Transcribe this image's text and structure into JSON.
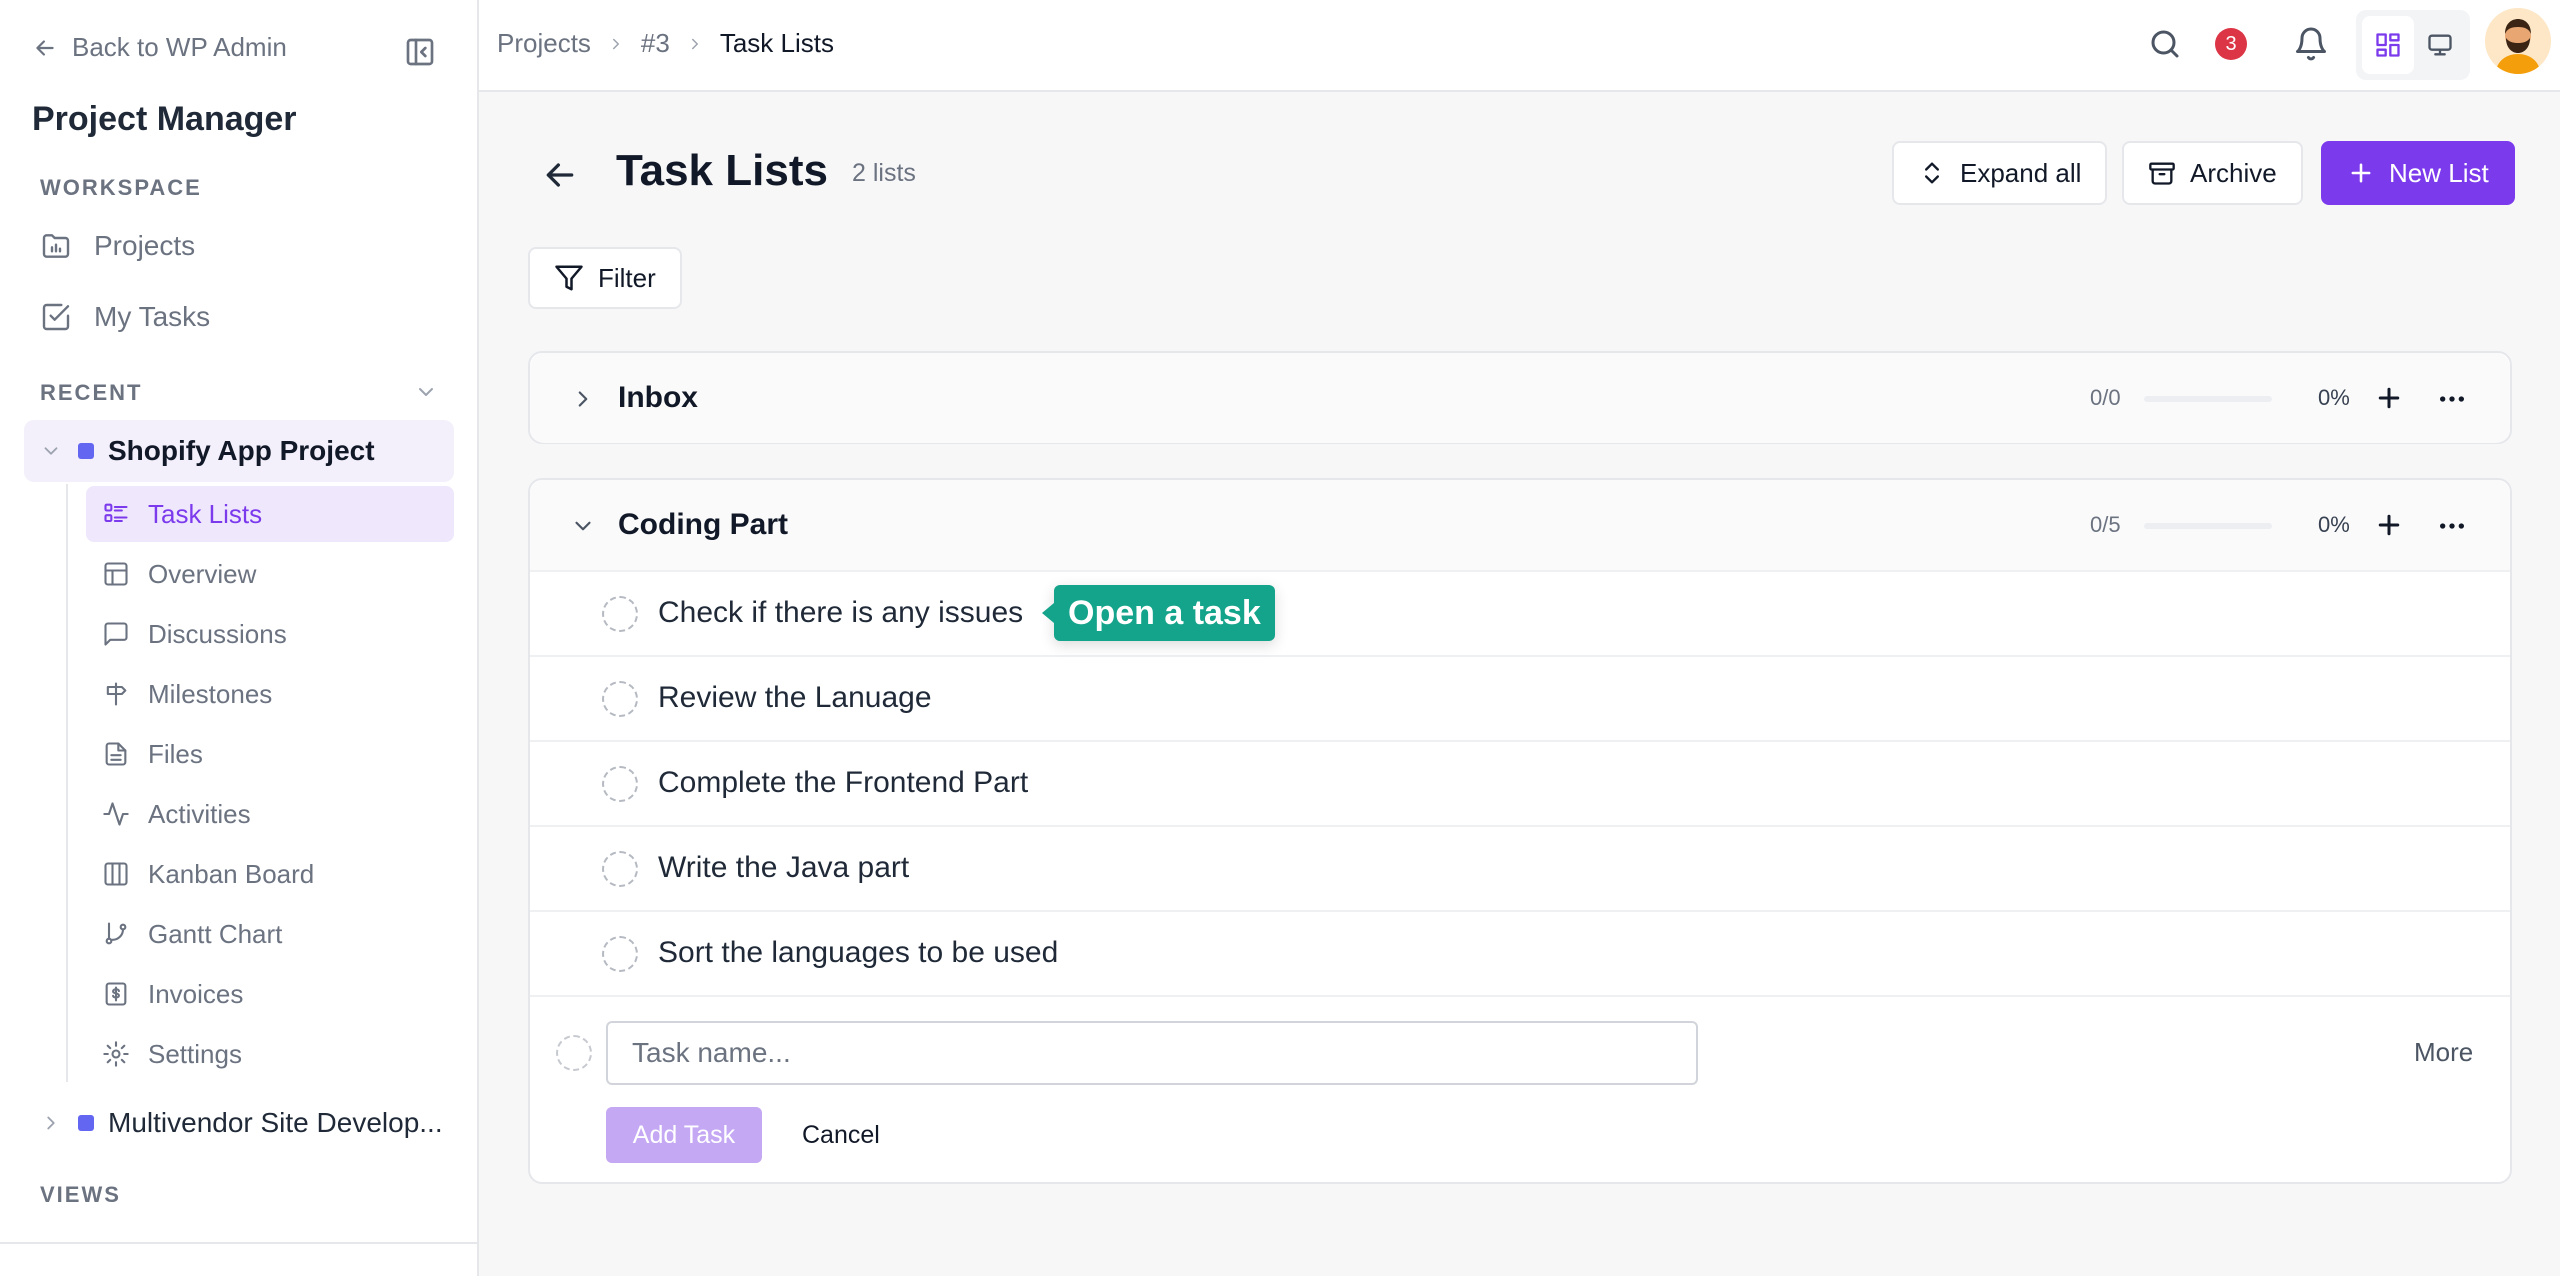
{
  "sidebar": {
    "back_label": "Back to WP Admin",
    "app_title": "Project Manager",
    "workspace_label": "WORKSPACE",
    "workspace_items": [
      {
        "label": "Projects",
        "icon": "folder-chart-icon"
      },
      {
        "label": "My Tasks",
        "icon": "checkbox-icon"
      }
    ],
    "recent_label": "RECENT",
    "projects": [
      {
        "name": "Shopify App Project",
        "expanded": true,
        "color": "#6366f1"
      },
      {
        "name": "Multivendor Site Develop...",
        "expanded": false,
        "color": "#6366f1"
      }
    ],
    "subnav": [
      {
        "label": "Task Lists",
        "icon": "list-icon",
        "active": true
      },
      {
        "label": "Overview",
        "icon": "layout-icon"
      },
      {
        "label": "Discussions",
        "icon": "message-icon"
      },
      {
        "label": "Milestones",
        "icon": "signpost-icon"
      },
      {
        "label": "Files",
        "icon": "file-icon"
      },
      {
        "label": "Activities",
        "icon": "activity-icon"
      },
      {
        "label": "Kanban Board",
        "icon": "columns-icon"
      },
      {
        "label": "Gantt Chart",
        "icon": "git-branch-icon"
      },
      {
        "label": "Invoices",
        "icon": "dollar-icon"
      },
      {
        "label": "Settings",
        "icon": "gear-icon"
      }
    ],
    "views_label": "VIEWS"
  },
  "topbar": {
    "breadcrumbs": [
      "Projects",
      "#3",
      "Task Lists"
    ],
    "notification_count": "3"
  },
  "page": {
    "title": "Task Lists",
    "count": "2 lists",
    "expand_label": "Expand all",
    "archive_label": "Archive",
    "new_list_label": "New List",
    "filter_label": "Filter"
  },
  "lists": [
    {
      "name": "Inbox",
      "ratio": "0/0",
      "percent": "0%",
      "progress": 0,
      "expanded": false
    },
    {
      "name": "Coding Part",
      "ratio": "0/5",
      "percent": "0%",
      "progress": 0,
      "expanded": true,
      "tasks": [
        "Check if there is any issues",
        "Review the Lanuage",
        "Complete the Frontend Part",
        "Write the Java part",
        "Sort the languages to be used"
      ]
    }
  ],
  "tooltip": "Open a task",
  "task_form": {
    "placeholder": "Task name...",
    "more_label": "More",
    "add_label": "Add Task",
    "cancel_label": "Cancel"
  },
  "colors": {
    "accent": "#7c3aed",
    "accent_light": "#efe8fc",
    "tooltip": "#14a38b",
    "badge": "#dc3545"
  }
}
